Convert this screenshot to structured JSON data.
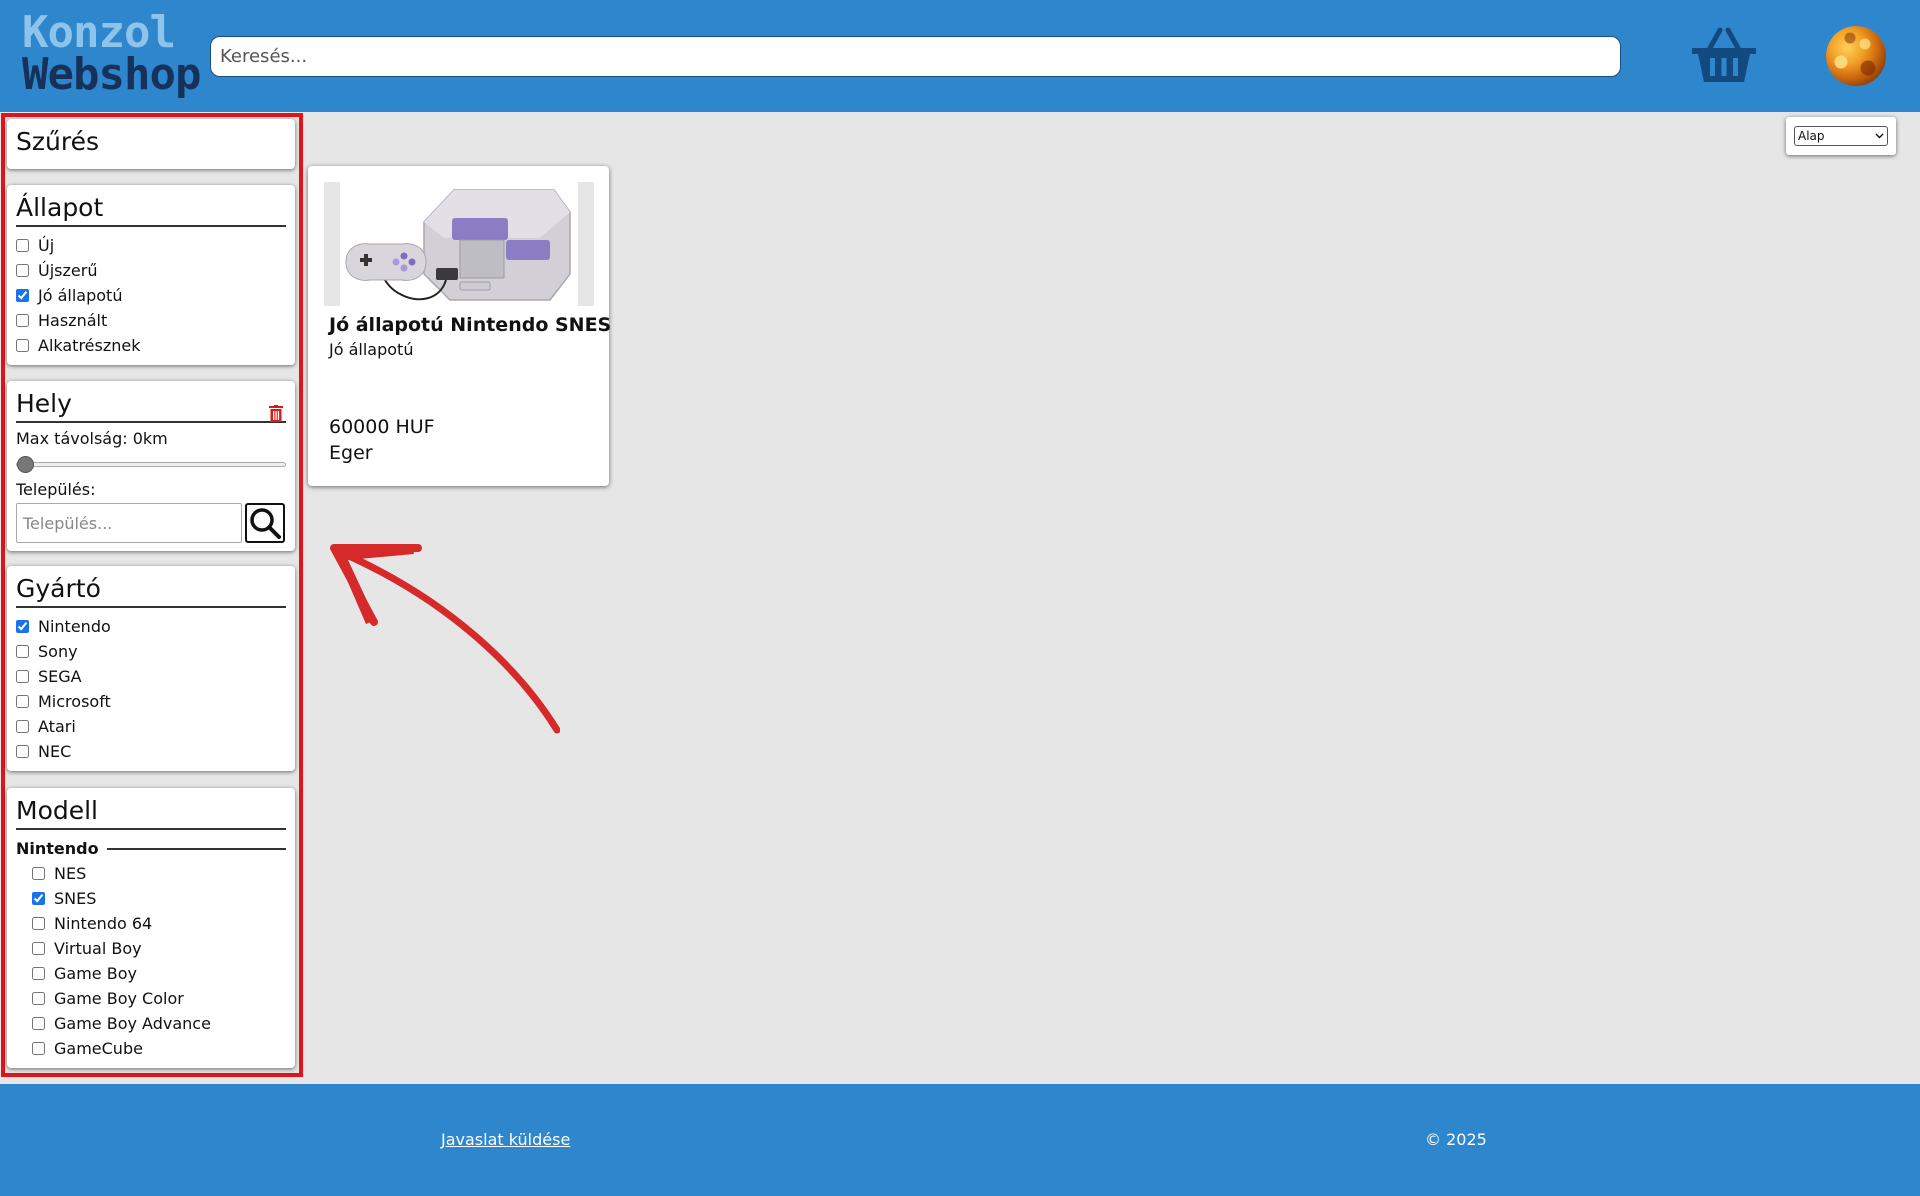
{
  "header": {
    "logo_line1": "Konzol",
    "logo_line2": "Webshop",
    "search_placeholder": "Keresés...",
    "basket_icon": "shopping-basket-icon",
    "avatar_icon": "user-avatar"
  },
  "filters": {
    "title": "Szűrés",
    "condition": {
      "title": "Állapot",
      "options": [
        {
          "label": "Új",
          "checked": false
        },
        {
          "label": "Újszerű",
          "checked": false
        },
        {
          "label": "Jó állapotú",
          "checked": true
        },
        {
          "label": "Használt",
          "checked": false
        },
        {
          "label": "Alkatrésznek",
          "checked": false
        }
      ]
    },
    "location": {
      "title": "Hely",
      "max_distance_label": "Max távolság: 0km",
      "max_distance_value": 0,
      "city_label": "Település:",
      "city_placeholder": "Település...",
      "trash_icon": "trash-icon",
      "search_icon": "magnifier-icon"
    },
    "manufacturer": {
      "title": "Gyártó",
      "options": [
        {
          "label": "Nintendo",
          "checked": true
        },
        {
          "label": "Sony",
          "checked": false
        },
        {
          "label": "SEGA",
          "checked": false
        },
        {
          "label": "Microsoft",
          "checked": false
        },
        {
          "label": "Atari",
          "checked": false
        },
        {
          "label": "NEC",
          "checked": false
        }
      ]
    },
    "model": {
      "title": "Modell",
      "group_label": "Nintendo",
      "options": [
        {
          "label": "NES",
          "checked": false
        },
        {
          "label": "SNES",
          "checked": true
        },
        {
          "label": "Nintendo 64",
          "checked": false
        },
        {
          "label": "Virtual Boy",
          "checked": false
        },
        {
          "label": "Game Boy",
          "checked": false
        },
        {
          "label": "Game Boy Color",
          "checked": false
        },
        {
          "label": "Game Boy Advance",
          "checked": false
        },
        {
          "label": "GameCube",
          "checked": false
        }
      ]
    }
  },
  "sort": {
    "selected": "Alap"
  },
  "products": [
    {
      "title": "Jó állapotú Nintendo SNES",
      "condition": "Jó állapotú",
      "price": "60000 HUF",
      "city": "Eger"
    }
  ],
  "footer": {
    "suggest_link": "Javaslat küldése",
    "copyright": "© 2025"
  },
  "colors": {
    "header_bg": "#2e86cc",
    "highlight_border": "#e0141b",
    "page_bg": "#e6e6e6"
  }
}
